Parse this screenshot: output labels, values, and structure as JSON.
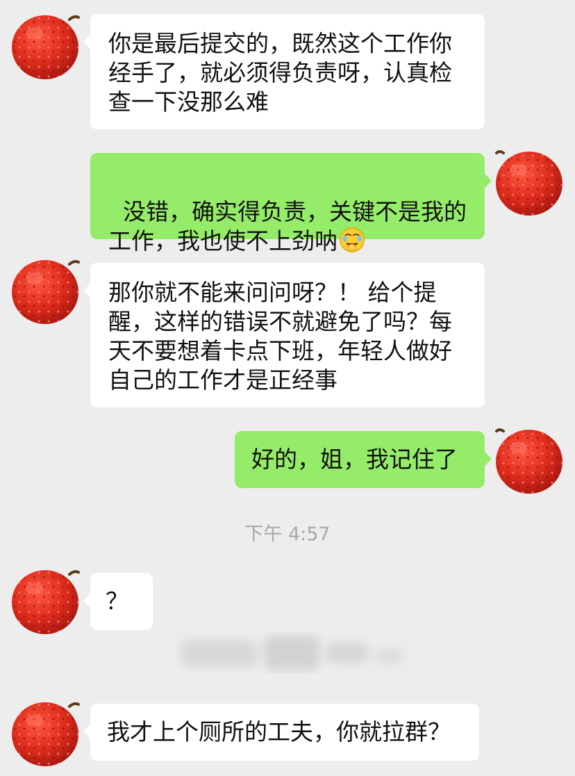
{
  "messages": [
    {
      "side": "left",
      "text": "你是最后提交的，既然这个工作你经手了，就必须得负责呀，认真检查一下没那么难"
    },
    {
      "side": "right",
      "text": "没错，确实得负责，关键不是我的工作，我也使不上劲呐",
      "emoji": "facepalm-crying-emoji"
    },
    {
      "side": "left",
      "text": "那你就不能来问问呀？！ 给个提醒，这样的错误不就避免了吗？每天不要想着卡点下班，年轻人做好自己的工作才是正经事"
    },
    {
      "side": "right",
      "text": "好的，姐，我记住了"
    },
    {
      "side": "left",
      "text": "？"
    },
    {
      "side": "left",
      "text": "我才上个厕所的工夫，你就拉群？"
    }
  ],
  "timestamp": "下午 4:57",
  "colors": {
    "background": "#ededed",
    "incoming_bubble": "#ffffff",
    "outgoing_bubble": "#95ec69",
    "timestamp_text": "#a8a8a8",
    "avatar": "#d7281e"
  },
  "avatar_icon": "lychee-avatar-icon"
}
